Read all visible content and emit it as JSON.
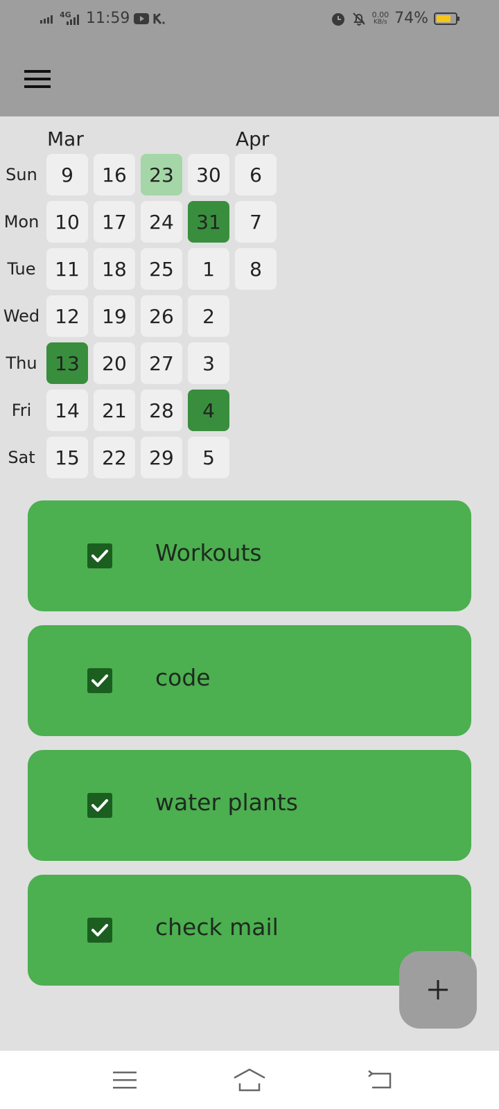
{
  "status_bar": {
    "network": "4G",
    "time": "11:59",
    "speed_value": "0.00",
    "speed_unit": "KB/s",
    "battery": "74%",
    "icons": [
      "signal-icon",
      "signal-4g-icon",
      "youtube-icon",
      "k-app-icon",
      "alarm-icon",
      "bell-off-icon",
      "battery-icon"
    ]
  },
  "app_bar": {
    "menu_icon": "menu-icon"
  },
  "calendar": {
    "months": [
      {
        "label": "Mar"
      },
      {
        "label": "Apr"
      }
    ],
    "day_names": [
      "Sun",
      "Mon",
      "Tue",
      "Wed",
      "Thu",
      "Fri",
      "Sat"
    ],
    "weeks": [
      [
        "9",
        "10",
        "11",
        "12",
        "13",
        "14",
        "15"
      ],
      [
        "16",
        "17",
        "18",
        "19",
        "20",
        "21",
        "22"
      ],
      [
        "23",
        "24",
        "25",
        "26",
        "27",
        "28",
        "29"
      ],
      [
        "30",
        "31",
        "1",
        "2",
        "3",
        "4",
        "5"
      ],
      [
        "6",
        "7",
        "8"
      ]
    ],
    "highlights": {
      "light": [
        "2-0"
      ],
      "dark": [
        "0-4",
        "3-1",
        "3-5"
      ]
    },
    "colors": {
      "cell": "#efefef",
      "light": "#a5d6a7",
      "dark": "#388e3c"
    }
  },
  "habits": [
    {
      "label": "Workouts",
      "checked": true
    },
    {
      "label": "code",
      "checked": true
    },
    {
      "label": "water plants",
      "checked": true
    },
    {
      "label": "check mail",
      "checked": true
    }
  ],
  "fab": {
    "icon": "plus-icon"
  },
  "nav_bar": {
    "icons": [
      "recents-icon",
      "home-icon",
      "back-icon"
    ]
  },
  "colors": {
    "app_bar": "#9e9e9e",
    "habit_card": "#4caf50",
    "checkbox": "#1b5e20"
  }
}
